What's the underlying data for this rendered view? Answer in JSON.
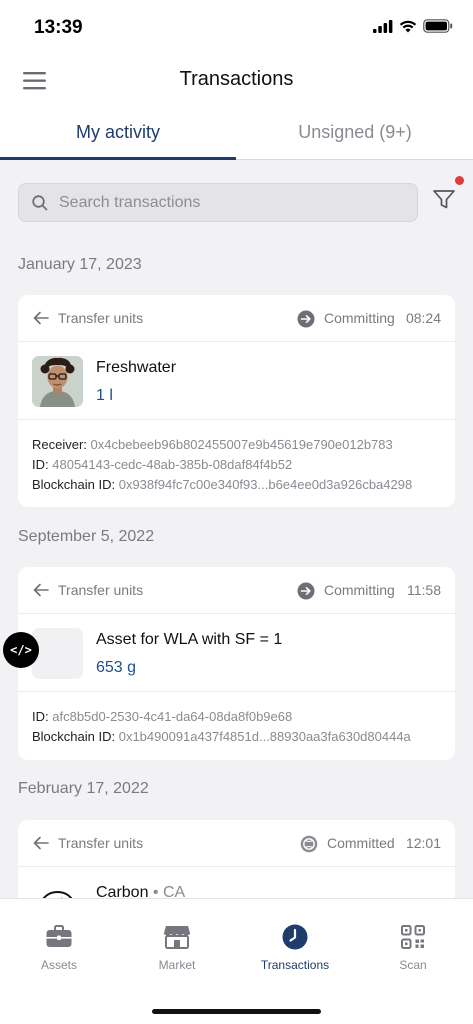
{
  "status_bar": {
    "time": "13:39"
  },
  "header": {
    "title": "Transactions"
  },
  "tabs": [
    {
      "label": "My activity",
      "active": true
    },
    {
      "label": "Unsigned (9+)",
      "active": false
    }
  ],
  "search": {
    "placeholder": "Search transactions",
    "value": ""
  },
  "filter": {
    "has_notification": true,
    "dot_color": "#e03b3b"
  },
  "groups": [
    {
      "date": "January 17, 2023",
      "transaction": {
        "type": "Transfer units",
        "status": "Committing",
        "time": "08:24",
        "asset_name": "Freshwater",
        "quantity": "1 l",
        "receiver_label": "Receiver:",
        "receiver": "0x4cbebeeb96b802455007e9b45619e790e012b783",
        "id_label": "ID:",
        "id": "48054143-cedc-48ab-385b-08daf84f4b52",
        "blockchain_label": "Blockchain ID:",
        "blockchain_id": "0x938f94fc7c00e340f93...b6e4ee0d3a926cba4298"
      }
    },
    {
      "date": "September 5, 2022",
      "transaction": {
        "type": "Transfer units",
        "status": "Committing",
        "time": "11:58",
        "asset_name": "Asset for WLA with SF = 1",
        "quantity": "653 g",
        "id_label": "ID:",
        "id": "afc8b5d0-2530-4c41-da64-08da8f0b9e68",
        "blockchain_label": "Blockchain ID:",
        "blockchain_id": "0x1b490091a437f4851d...88930aa3fa630d80444a"
      }
    },
    {
      "date": "February 17, 2022",
      "transaction": {
        "type": "Transfer units",
        "status": "Committed",
        "time": "12:01",
        "asset_name": "Carbon",
        "region": " • CA"
      }
    }
  ],
  "dev_badge": "</>",
  "bottom_nav": [
    {
      "label": "Assets",
      "icon": "briefcase-icon",
      "active": false
    },
    {
      "label": "Market",
      "icon": "store-icon",
      "active": false
    },
    {
      "label": "Transactions",
      "icon": "clock-icon",
      "active": true
    },
    {
      "label": "Scan",
      "icon": "qr-code-icon",
      "active": false
    }
  ],
  "colors": {
    "accent": "#1f3c6b",
    "quantity": "#1f4f8f",
    "background": "#f2f2f4"
  }
}
